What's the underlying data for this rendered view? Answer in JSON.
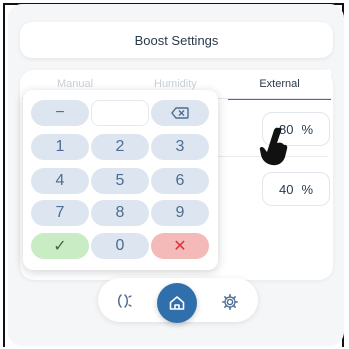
{
  "header": {
    "title": "Boost Settings"
  },
  "tabs": [
    {
      "label": "Manual"
    },
    {
      "label": "Humidity"
    },
    {
      "label": "External"
    }
  ],
  "fields": [
    {
      "value": "80",
      "unit": "%"
    },
    {
      "value": "40",
      "unit": "%"
    }
  ],
  "keypad": {
    "display_value": "",
    "minus": "−",
    "backspace_icon": "backspace-icon",
    "digits": [
      "1",
      "2",
      "3",
      "4",
      "5",
      "6",
      "7",
      "8",
      "9",
      "0"
    ],
    "confirm": "✓",
    "cancel": "✕"
  },
  "nav": {
    "left_icon": "fan-mode-icon",
    "home_icon": "home-icon",
    "settings_icon": "gear-icon"
  },
  "colors": {
    "accent": "#2f6fab",
    "key_bg": "#dde6f0",
    "confirm_bg": "#c9ecc4",
    "cancel_bg": "#f4b9b9"
  }
}
